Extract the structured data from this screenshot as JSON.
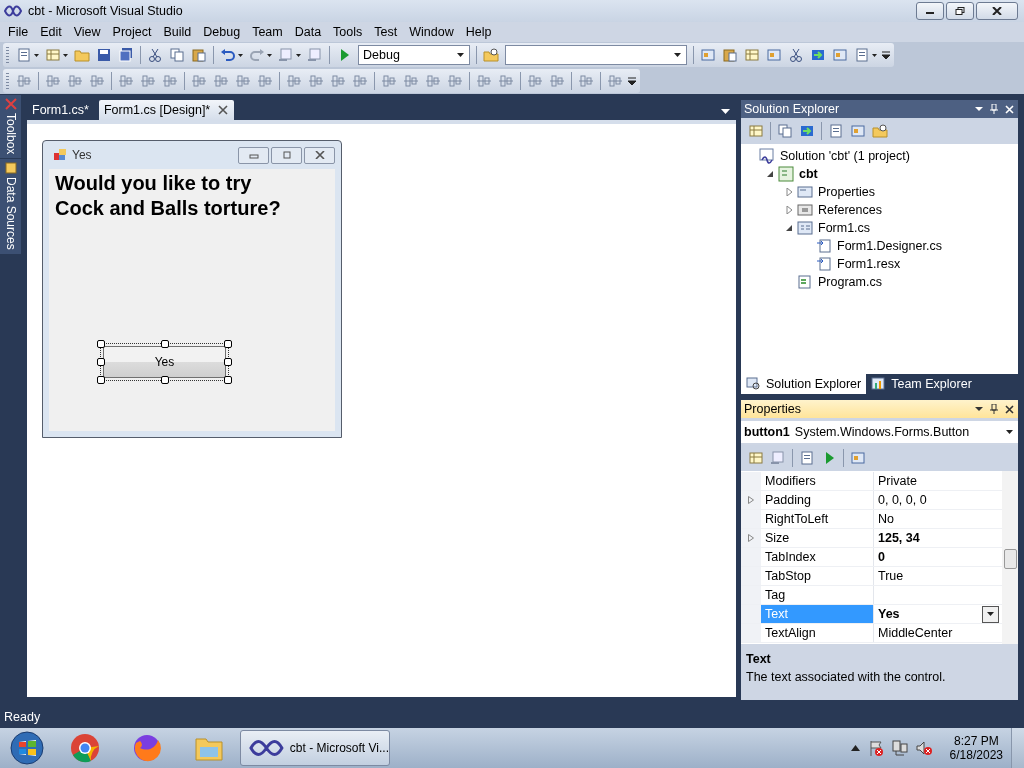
{
  "window": {
    "title": "cbt - Microsoft Visual Studio"
  },
  "menu": [
    "File",
    "Edit",
    "View",
    "Project",
    "Build",
    "Debug",
    "Team",
    "Data",
    "Tools",
    "Test",
    "Window",
    "Help"
  ],
  "toolbar": {
    "configuration": "Debug"
  },
  "side_tabs": [
    {
      "label": "Toolbox",
      "kind": "toolbox"
    },
    {
      "label": "Data Sources",
      "kind": "datasources"
    }
  ],
  "document_tabs": [
    {
      "label": "Form1.cs*",
      "selected": false
    },
    {
      "label": "Form1.cs [Design]*",
      "selected": true
    }
  ],
  "form": {
    "title": "Yes",
    "label": "Would you like to try Cock and Balls torture?",
    "button": {
      "text": "Yes",
      "selected": true
    }
  },
  "solution_explorer": {
    "title": "Solution Explorer",
    "tree": [
      {
        "label": "Solution 'cbt' (1 project)",
        "kind": "solution",
        "bold": false,
        "children": [
          {
            "label": "cbt",
            "kind": "project",
            "bold": true,
            "expanded": true,
            "children": [
              {
                "label": "Properties",
                "kind": "properties",
                "bold": false,
                "expanded": false
              },
              {
                "label": "References",
                "kind": "references",
                "bold": false,
                "expanded": false
              },
              {
                "label": "Form1.cs",
                "kind": "form",
                "bold": false,
                "expanded": true,
                "children": [
                  {
                    "label": "Form1.Designer.cs",
                    "kind": "dependent",
                    "bold": false
                  },
                  {
                    "label": "Form1.resx",
                    "kind": "dependent",
                    "bold": false
                  }
                ]
              },
              {
                "label": "Program.cs",
                "kind": "csharp",
                "bold": false
              }
            ]
          }
        ]
      }
    ],
    "bottom_tabs": [
      {
        "label": "Solution Explorer",
        "selected": true
      },
      {
        "label": "Team Explorer",
        "selected": false
      }
    ]
  },
  "properties": {
    "title": "Properties",
    "object_name": "button1",
    "object_type": "System.Windows.Forms.Button",
    "rows": [
      {
        "name": "Modifiers",
        "value": "Private",
        "expandable": false,
        "modified": false,
        "selected": false
      },
      {
        "name": "Padding",
        "value": "0, 0, 0, 0",
        "expandable": true,
        "modified": false,
        "selected": false
      },
      {
        "name": "RightToLeft",
        "value": "No",
        "expandable": false,
        "modified": false,
        "selected": false
      },
      {
        "name": "Size",
        "value": "125, 34",
        "expandable": true,
        "modified": true,
        "selected": false
      },
      {
        "name": "TabIndex",
        "value": "0",
        "expandable": false,
        "modified": true,
        "selected": false
      },
      {
        "name": "TabStop",
        "value": "True",
        "expandable": false,
        "modified": false,
        "selected": false
      },
      {
        "name": "Tag",
        "expandable": false,
        "selected": false
      },
      {
        "name": "Text",
        "value": "Yes",
        "expandable": false,
        "modified": true,
        "selected": true
      },
      {
        "name": "TextAlign",
        "value": "MiddleCenter",
        "expandable": false,
        "modified": false,
        "selected": false
      }
    ],
    "description": {
      "title": "Text",
      "text": "The text associated with the control."
    }
  },
  "status_bar": "Ready",
  "taskbar": {
    "pinned": [
      {
        "kind": "chrome"
      },
      {
        "kind": "firefox"
      },
      {
        "kind": "explorer"
      }
    ],
    "window_button": "cbt - Microsoft Vi...",
    "time": "8:27 PM",
    "date": "6/18/2023"
  }
}
